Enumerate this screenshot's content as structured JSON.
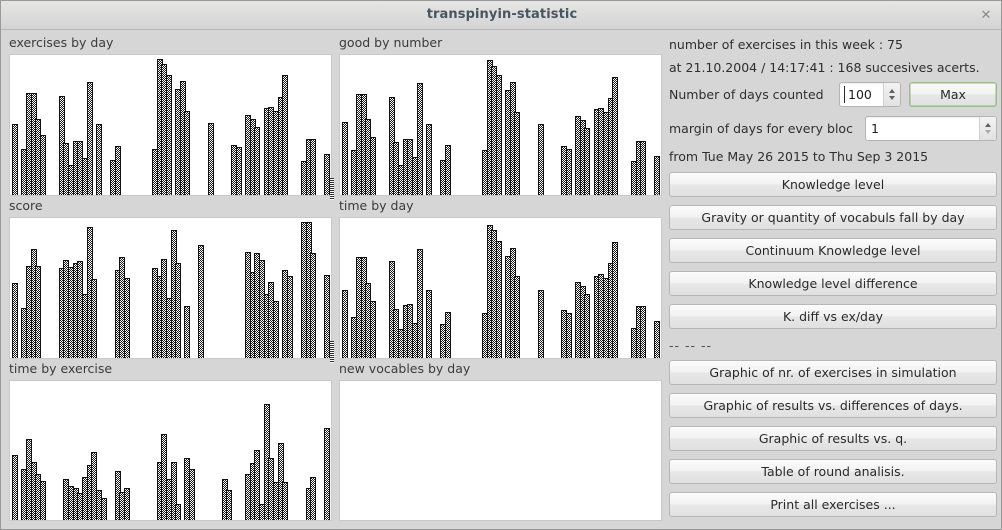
{
  "window": {
    "title": "transpinyin-statistic",
    "close_label": "✕"
  },
  "charts": [
    {
      "label": "exercises by day"
    },
    {
      "label": "good by number"
    },
    {
      "label": "score"
    },
    {
      "label": "time by day"
    },
    {
      "label": "time by exercise"
    },
    {
      "label": "new vocables by day"
    }
  ],
  "panel": {
    "info_week": "number of exercises in this week : 75",
    "info_alerts": "at 21.10.2004 / 14:17:41 : 168 succesives acerts.",
    "days_counted_label": "Number of days counted",
    "days_counted_value": "100",
    "max_button": "Max",
    "margin_label": "margin of days for every bloc",
    "margin_value": "1",
    "range_text": "from Tue May 26 2015 to Thu Sep 3 2015",
    "separator": "-- -- --",
    "buttons_top": [
      "Knowledge level",
      "Gravity or quantity of vocabuls fall by day",
      "Continuum Knowledge level",
      "Knowledge level difference",
      "K. diff vs ex/day"
    ],
    "buttons_bottom": [
      "Graphic of nr. of exercises in simulation",
      "Graphic of results vs. differences of days.",
      "Graphic of results vs. q.",
      "Table of round analisis.",
      "Print all exercises ..."
    ]
  },
  "chart_data": [
    {
      "type": "bar",
      "title": "exercises by day",
      "xlabel": "",
      "ylabel": "",
      "ylim": [
        0,
        100
      ],
      "grid": false,
      "legend": "none",
      "values": [
        52,
        0,
        34,
        75,
        75,
        56,
        44,
        0,
        0,
        0,
        73,
        38,
        22,
        40,
        40,
        27,
        83,
        0,
        52,
        0,
        0,
        26,
        36,
        0,
        0,
        0,
        0,
        0,
        0,
        0,
        34,
        100,
        96,
        88,
        0,
        78,
        84,
        62,
        0,
        0,
        0,
        0,
        53,
        0,
        0,
        0,
        0,
        37,
        35,
        0,
        59,
        56,
        50,
        0,
        64,
        65,
        62,
        72,
        88,
        0,
        0,
        0,
        25,
        41,
        41,
        0,
        0,
        30
      ]
    },
    {
      "type": "bar",
      "title": "good by number",
      "xlabel": "",
      "ylabel": "",
      "ylim": [
        0,
        100
      ],
      "grid": false,
      "legend": "none",
      "values": [
        54,
        0,
        33,
        74,
        74,
        56,
        43,
        0,
        0,
        0,
        72,
        39,
        22,
        41,
        41,
        28,
        82,
        0,
        52,
        0,
        0,
        26,
        37,
        0,
        0,
        0,
        0,
        0,
        0,
        0,
        33,
        99,
        95,
        88,
        0,
        77,
        83,
        61,
        0,
        0,
        0,
        0,
        52,
        0,
        0,
        0,
        0,
        36,
        34,
        0,
        58,
        55,
        49,
        0,
        63,
        64,
        61,
        71,
        87,
        0,
        0,
        0,
        25,
        40,
        40,
        0,
        0,
        29
      ]
    },
    {
      "type": "bar",
      "title": "score",
      "xlabel": "",
      "ylabel": "",
      "ylim": [
        0,
        100
      ],
      "grid": false,
      "legend": "none",
      "values": [
        55,
        0,
        37,
        68,
        80,
        68,
        0,
        0,
        0,
        0,
        66,
        72,
        67,
        70,
        71,
        47,
        96,
        58,
        0,
        0,
        0,
        0,
        65,
        74,
        59,
        0,
        0,
        0,
        0,
        0,
        66,
        60,
        73,
        44,
        94,
        70,
        0,
        38,
        0,
        0,
        83,
        0,
        0,
        0,
        0,
        0,
        0,
        0,
        0,
        0,
        78,
        63,
        77,
        72,
        47,
        56,
        42,
        0,
        65,
        60,
        0,
        0,
        100,
        100,
        77,
        0,
        0,
        61
      ]
    },
    {
      "type": "bar",
      "title": "time by day",
      "xlabel": "",
      "ylabel": "",
      "ylim": [
        0,
        100
      ],
      "grid": false,
      "legend": "none",
      "values": [
        50,
        0,
        30,
        74,
        74,
        55,
        42,
        0,
        0,
        0,
        71,
        36,
        21,
        39,
        40,
        26,
        80,
        0,
        50,
        0,
        0,
        25,
        34,
        0,
        0,
        0,
        0,
        0,
        0,
        0,
        33,
        98,
        94,
        86,
        0,
        75,
        81,
        60,
        0,
        0,
        0,
        0,
        50,
        0,
        0,
        0,
        0,
        35,
        33,
        0,
        56,
        53,
        47,
        0,
        60,
        62,
        59,
        70,
        85,
        0,
        0,
        0,
        22,
        38,
        38,
        0,
        0,
        27
      ]
    },
    {
      "type": "bar",
      "title": "time by exercise",
      "xlabel": "",
      "ylabel": "",
      "ylim": [
        0,
        100
      ],
      "grid": false,
      "legend": "none",
      "values": [
        48,
        0,
        38,
        60,
        43,
        34,
        29,
        0,
        0,
        0,
        0,
        30,
        25,
        24,
        20,
        32,
        41,
        50,
        22,
        16,
        0,
        0,
        36,
        21,
        24,
        0,
        0,
        0,
        0,
        0,
        0,
        43,
        64,
        30,
        43,
        12,
        0,
        46,
        38,
        0,
        0,
        0,
        0,
        0,
        0,
        30,
        22,
        0,
        0,
        0,
        34,
        42,
        52,
        12,
        86,
        46,
        28,
        57,
        28,
        0,
        0,
        0,
        0,
        24,
        32,
        0,
        0,
        68
      ]
    },
    {
      "type": "bar",
      "title": "new vocables by day",
      "xlabel": "",
      "ylabel": "",
      "ylim": [
        0,
        100
      ],
      "grid": false,
      "legend": "none",
      "values": []
    }
  ]
}
